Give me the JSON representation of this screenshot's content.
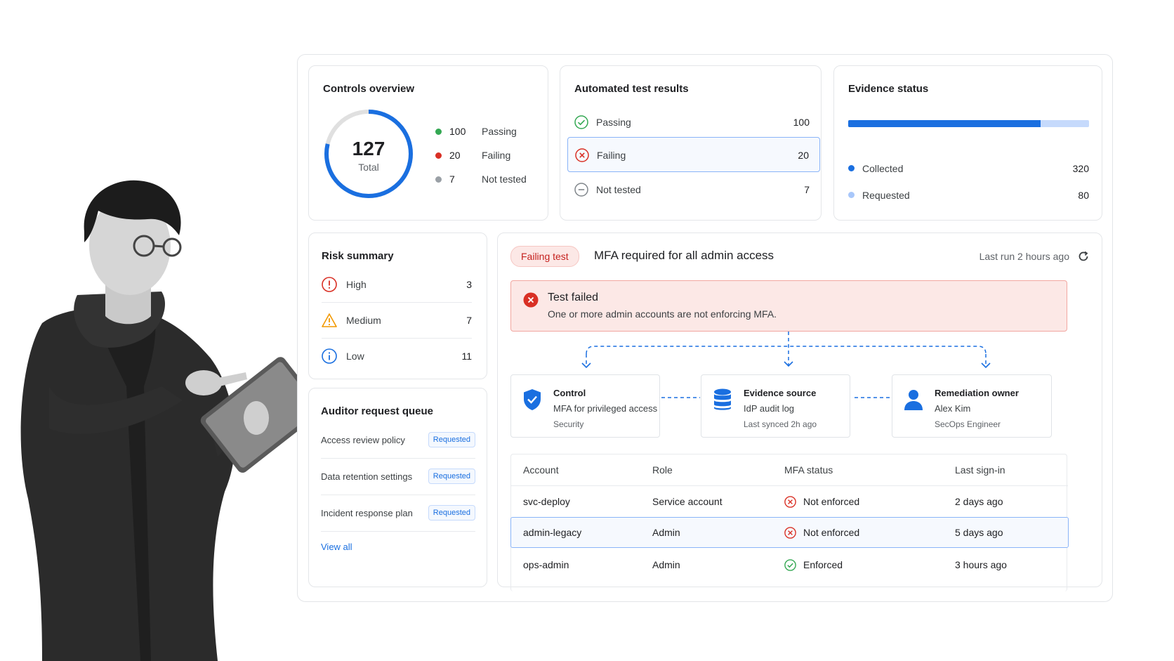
{
  "colors": {
    "primary": "#1a6fe0",
    "primary_light": "#c6dafc",
    "fail": "#d93025",
    "pass": "#34a853",
    "warn": "#f29900",
    "neutral": "#9aa0a6"
  },
  "controls_overview": {
    "title": "Controls overview",
    "total": "127",
    "total_label": "Total",
    "legend": [
      {
        "value": "100",
        "label": "Passing",
        "color": "#34a853"
      },
      {
        "value": "20",
        "label": "Failing",
        "color": "#d93025"
      },
      {
        "value": "7",
        "label": "Not tested",
        "color": "#9aa0a6"
      }
    ]
  },
  "automated_tests": {
    "title": "Automated test results",
    "rows": [
      {
        "label": "Passing",
        "value": "100",
        "icon": "check-circle-icon"
      },
      {
        "label": "Failing",
        "value": "20",
        "icon": "x-circle-icon"
      },
      {
        "label": "Not tested",
        "value": "7",
        "icon": "minus-circle-icon"
      }
    ]
  },
  "evidence": {
    "title": "Evidence status",
    "collected_fraction": 0.8,
    "rows": [
      {
        "label": "Collected",
        "value": "320",
        "color": "#1a6fe0"
      },
      {
        "label": "Requested",
        "value": "80",
        "color": "#a8c7fa"
      }
    ]
  },
  "risk_summary": {
    "title": "Risk summary",
    "rows": [
      {
        "label": "High",
        "value": "3",
        "icon": "alert-circle-icon"
      },
      {
        "label": "Medium",
        "value": "7",
        "icon": "warning-triangle-icon"
      },
      {
        "label": "Low",
        "value": "11",
        "icon": "info-circle-icon"
      }
    ]
  },
  "auditor_queue": {
    "title": "Auditor request queue",
    "items": [
      {
        "label": "Access review policy",
        "status": "Requested"
      },
      {
        "label": "Data retention settings",
        "status": "Requested"
      },
      {
        "label": "Incident response plan",
        "status": "Requested"
      }
    ],
    "view_all": "View all"
  },
  "detail": {
    "chip": "Failing test",
    "title": "MFA required for all admin access",
    "last_run": "Last run 2 hours ago",
    "alert_title": "Test failed",
    "alert_message": "One or more admin accounts are not enforcing MFA.",
    "nodes": [
      {
        "l1": "Control",
        "l2": "MFA for privileged access",
        "l3": "Security",
        "icon": "shield-check-icon"
      },
      {
        "l1": "Evidence source",
        "l2": "IdP audit log",
        "l3": "Last synced 2h ago",
        "icon": "database-icon"
      },
      {
        "l1": "Remediation owner",
        "l2": "Alex Kim",
        "l3": "SecOps Engineer",
        "icon": "person-icon"
      }
    ],
    "table": {
      "headers": [
        "Account",
        "Role",
        "MFA status",
        "Last sign-in"
      ],
      "rows": [
        {
          "account": "svc-deploy",
          "role": "Service account",
          "status": "Not enforced",
          "last": "2 days ago"
        },
        {
          "account": "admin-legacy",
          "role": "Admin",
          "status": "Not enforced",
          "last": "5 days ago"
        },
        {
          "account": "ops-admin",
          "role": "Admin",
          "status": "Enforced",
          "last": "3 hours ago"
        }
      ]
    }
  }
}
